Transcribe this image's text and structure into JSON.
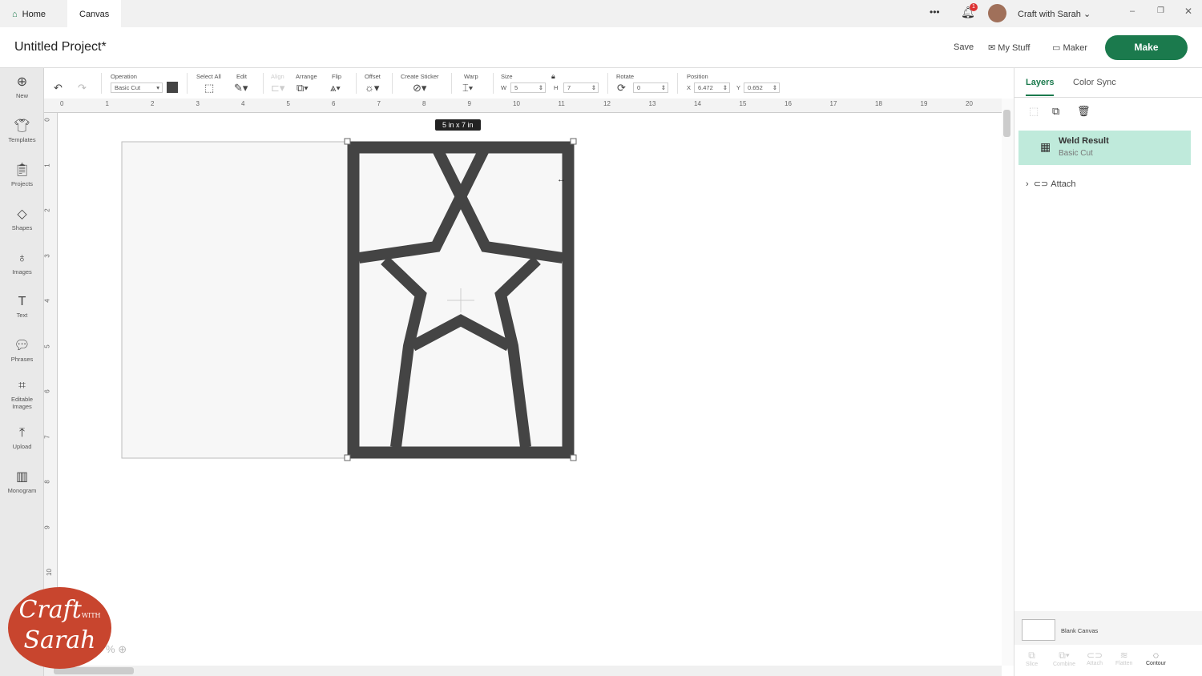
{
  "topbar": {
    "tabs": [
      "Home",
      "Canvas"
    ],
    "more": "•••",
    "notifications": "1",
    "user": "Craft with Sarah"
  },
  "header": {
    "title": "Untitled Project*",
    "save": "Save",
    "my_stuff": "My Stuff",
    "maker": "Maker",
    "make": "Make"
  },
  "sidebar": [
    {
      "label": "New",
      "icon": "plus-circle-icon"
    },
    {
      "label": "Templates",
      "icon": "shirt-icon"
    },
    {
      "label": "Projects",
      "icon": "clipboard-icon"
    },
    {
      "label": "Shapes",
      "icon": "shapes-icon"
    },
    {
      "label": "Images",
      "icon": "bulb-icon"
    },
    {
      "label": "Text",
      "icon": "text-icon"
    },
    {
      "label": "Phrases",
      "icon": "speech-icon"
    },
    {
      "label": "Editable Images",
      "icon": "editable-image-icon"
    },
    {
      "label": "Upload",
      "icon": "upload-icon"
    },
    {
      "label": "Monogram",
      "icon": "monogram-icon"
    }
  ],
  "toolbar": {
    "operation_label": "Operation",
    "operation": "Basic Cut",
    "select_all": "Select All",
    "edit": "Edit",
    "align": "Align",
    "arrange": "Arrange",
    "flip": "Flip",
    "offset": "Offset",
    "create_sticker": "Create Sticker",
    "warp": "Warp",
    "size": "Size",
    "w_label": "W",
    "w": "5",
    "h_label": "H",
    "h": "7",
    "rotate": "Rotate",
    "rotate_value": "0",
    "position": "Position",
    "x_label": "X",
    "x": "6.472",
    "y_label": "Y",
    "y": "0.652"
  },
  "ruler": {
    "top": [
      "0",
      "1",
      "2",
      "3",
      "4",
      "5",
      "6",
      "7",
      "8",
      "9",
      "10",
      "11",
      "12",
      "13",
      "14",
      "15",
      "16",
      "17",
      "18",
      "19",
      "20"
    ],
    "left": [
      "0",
      "1",
      "2",
      "3",
      "4",
      "5",
      "6",
      "7",
      "8",
      "9",
      "10"
    ]
  },
  "canvas": {
    "size_tooltip": "5 in x 7 in",
    "zoom": "%"
  },
  "panel": {
    "tabs": [
      "Layers",
      "Color Sync"
    ],
    "layer_name": "Weld Result",
    "layer_op": "Basic Cut",
    "attach": "Attach",
    "blank_canvas": "Blank Canvas",
    "actions": [
      "Slice",
      "Combine",
      "Attach",
      "Flatten",
      "Contour"
    ]
  },
  "logo": {
    "line1": "Craft",
    "with": "WITH",
    "line2": "Sarah"
  },
  "colors": {
    "accent": "#1b7a4d",
    "selected_layer": "#bfeadb",
    "shape": "#444444"
  }
}
